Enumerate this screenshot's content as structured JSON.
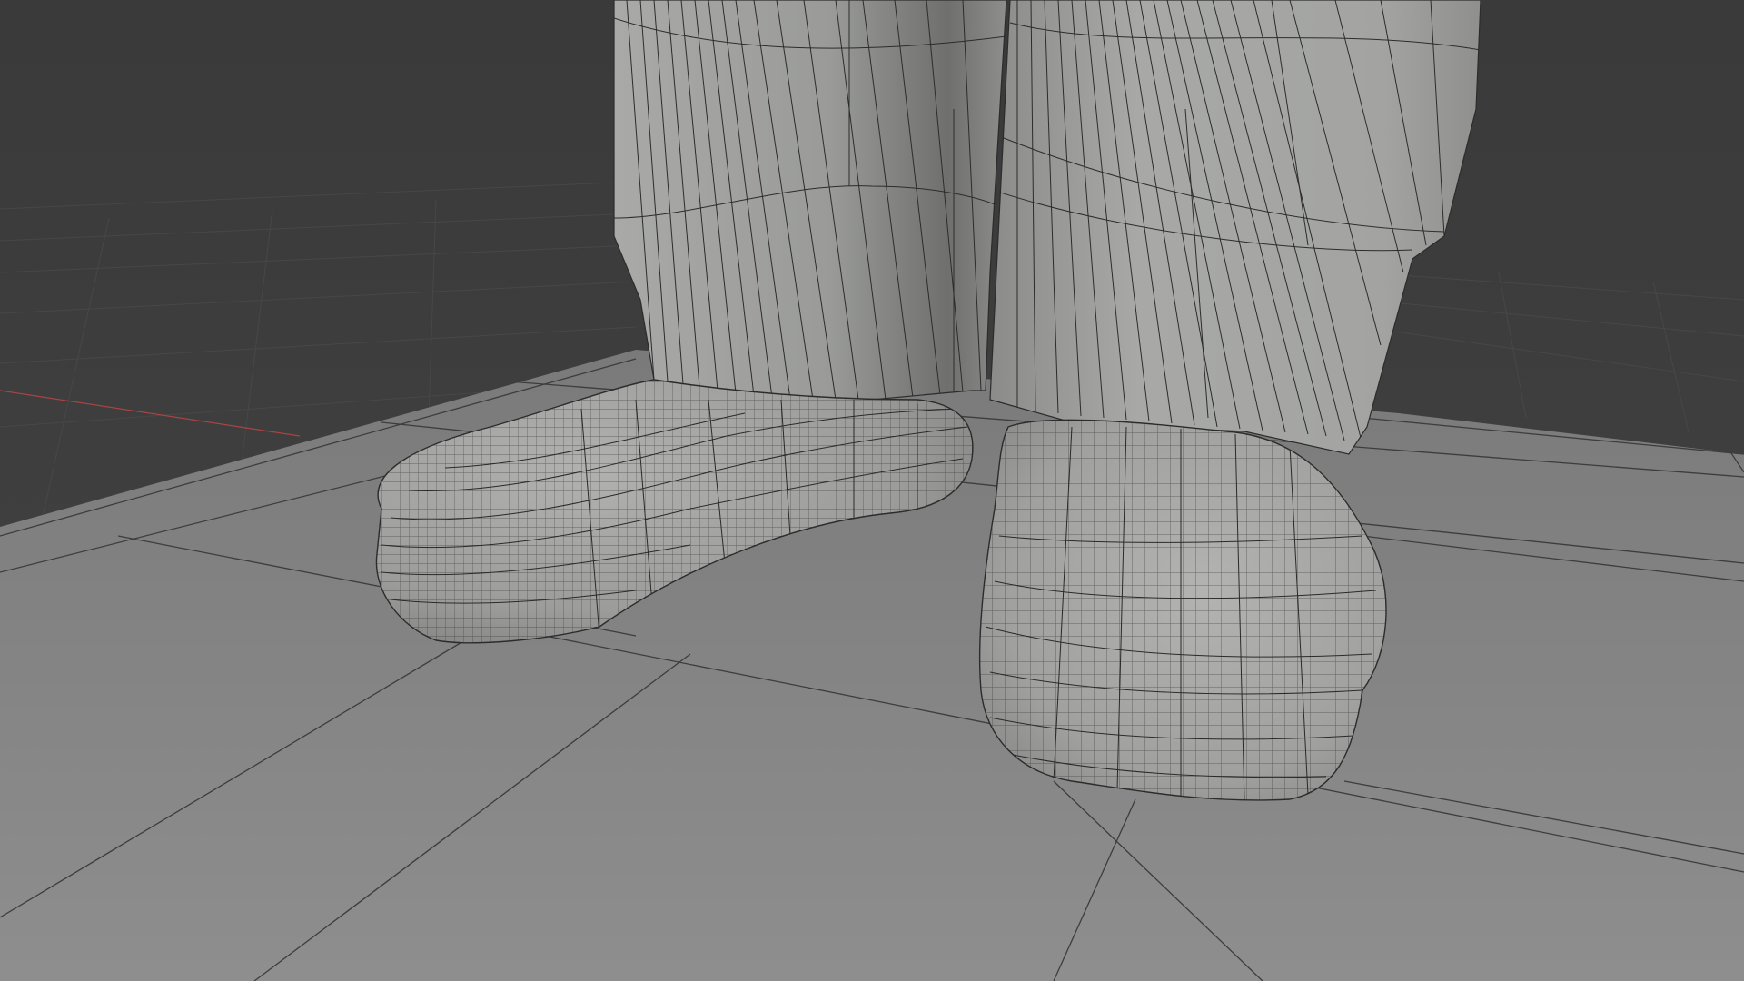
{
  "viewport": {
    "mode": "3D viewport",
    "shading": "solid",
    "wireframe_overlay": true,
    "background_color": "#3b3b3b",
    "floor_color": "#8a8a8a",
    "mesh_color": "#9d9e9c",
    "x_axis_color": "#a84444"
  },
  "scene": {
    "objects": [
      "floor-plane",
      "left-pant-leg",
      "right-pant-leg",
      "left-shoe",
      "right-shoe"
    ]
  }
}
